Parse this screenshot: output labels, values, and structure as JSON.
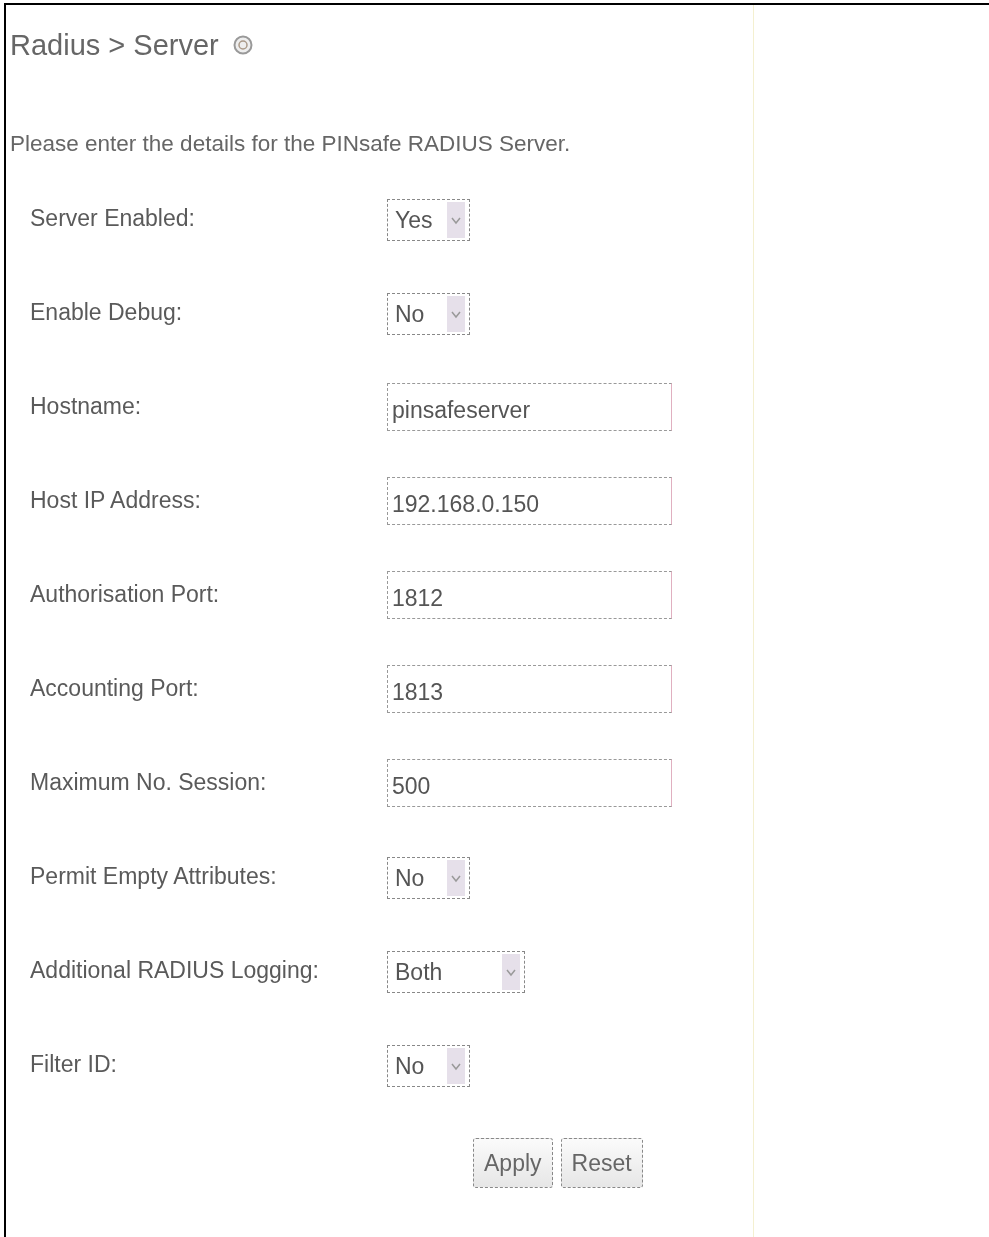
{
  "title": "Radius > Server",
  "description": "Please enter the details for the PINsafe RADIUS Server.",
  "fields": [
    {
      "label": "Server Enabled:",
      "kind": "select",
      "value": "Yes"
    },
    {
      "label": "Enable Debug:",
      "kind": "select",
      "value": "No"
    },
    {
      "label": "Hostname:",
      "kind": "text",
      "value": "pinsafeserver"
    },
    {
      "label": "Host IP Address:",
      "kind": "text",
      "value": "192.168.0.150"
    },
    {
      "label": "Authorisation Port:",
      "kind": "text",
      "value": "1812"
    },
    {
      "label": "Accounting Port:",
      "kind": "text",
      "value": "1813"
    },
    {
      "label": "Maximum No. Session:",
      "kind": "text",
      "value": "500"
    },
    {
      "label": "Permit Empty Attributes:",
      "kind": "select",
      "value": "No"
    },
    {
      "label": "Additional RADIUS Logging:",
      "kind": "select",
      "value": "Both",
      "wide": true
    },
    {
      "label": "Filter ID:",
      "kind": "select",
      "value": "No"
    }
  ],
  "buttons": [
    "Apply",
    "Reset"
  ]
}
